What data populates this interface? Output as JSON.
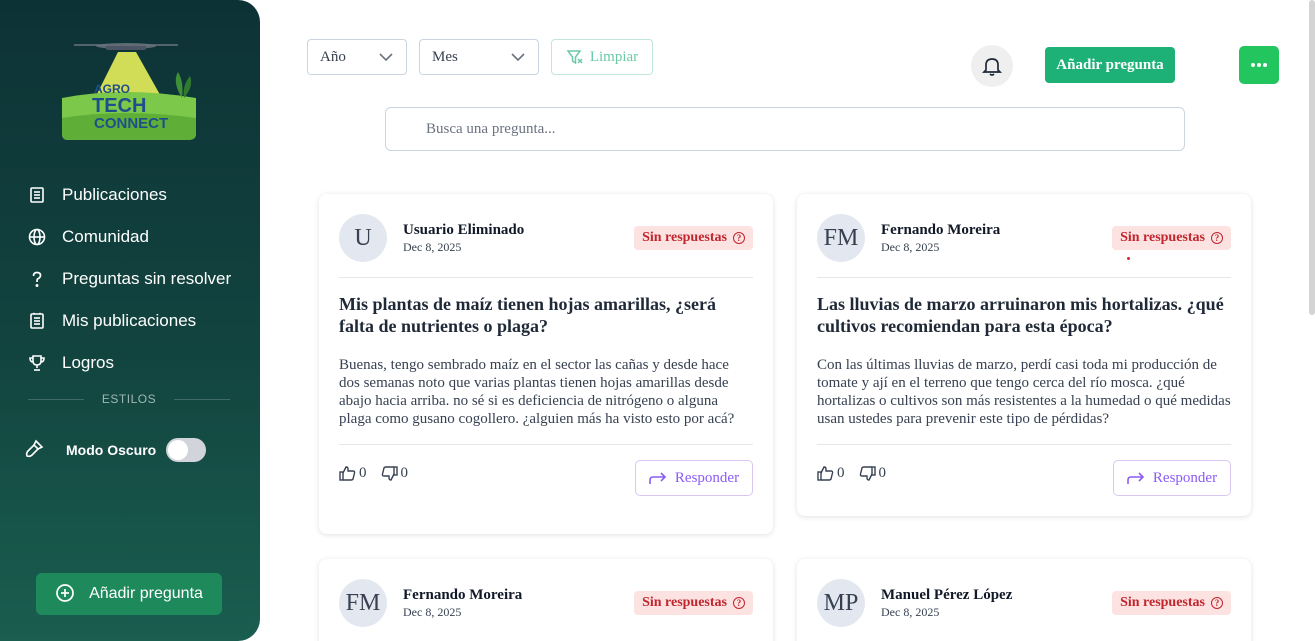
{
  "sidebar": {
    "logo": {
      "line1": "AGRO",
      "line2": "TECH",
      "line3": "CONNECT"
    },
    "items": [
      {
        "label": "Publicaciones",
        "icon": "document-icon"
      },
      {
        "label": "Comunidad",
        "icon": "globe-icon"
      },
      {
        "label": "Preguntas sin resolver",
        "icon": "question-icon"
      },
      {
        "label": "Mis publicaciones",
        "icon": "list-icon"
      },
      {
        "label": "Logros",
        "icon": "trophy-icon"
      }
    ],
    "section_label": "ESTILOS",
    "dark_mode_label": "Modo Oscuro",
    "dark_mode_on": false,
    "add_button": "Añadir pregunta"
  },
  "filters": {
    "year": "Año",
    "month": "Mes",
    "clear": "Limpiar"
  },
  "header": {
    "add_button": "Añadir pregunta"
  },
  "search": {
    "placeholder": "Busca una pregunta..."
  },
  "cards": [
    {
      "initials": "U",
      "author": "Usuario Eliminado",
      "date": "Dec 8, 2025",
      "status": "Sin respuestas",
      "title": "Mis plantas de maíz tienen hojas amarillas, ¿será falta de nutrientes o plaga?",
      "body": "Buenas, tengo sembrado maíz en el sector las cañas y desde hace dos semanas noto que varias plantas tienen hojas amarillas desde abajo hacia arriba. no sé si es deficiencia de nitrógeno o alguna plaga como gusano cogollero. ¿alguien más ha visto esto por acá?",
      "likes": "0",
      "dislikes": "0",
      "reply": "Responder"
    },
    {
      "initials": "FM",
      "author": "Fernando Moreira",
      "date": "Dec 8, 2025",
      "status": "Sin respuestas",
      "title": "Las lluvias de marzo arruinaron mis hortalizas. ¿qué cultivos recomiendan para esta época?",
      "body": "Con las últimas lluvias de marzo, perdí casi toda mi producción de tomate y ají en el terreno que tengo cerca del río mosca. ¿qué hortalizas o cultivos son más resistentes a la humedad o qué medidas usan ustedes para prevenir este tipo de pérdidas?",
      "likes": "0",
      "dislikes": "0",
      "reply": "Responder"
    },
    {
      "initials": "FM",
      "author": "Fernando Moreira",
      "date": "Dec 8, 2025",
      "status": "Sin respuestas"
    },
    {
      "initials": "MP",
      "author": "Manuel Pérez López",
      "date": "Dec 8, 2025",
      "status": "Sin respuestas"
    }
  ],
  "colors": {
    "primary": "#1db178",
    "sidebar_top": "#0d3236",
    "sidebar_bottom": "#1a5e50",
    "badge_bg": "#fde2e2",
    "badge_text": "#c0262d",
    "reply": "#8b5cf6"
  }
}
